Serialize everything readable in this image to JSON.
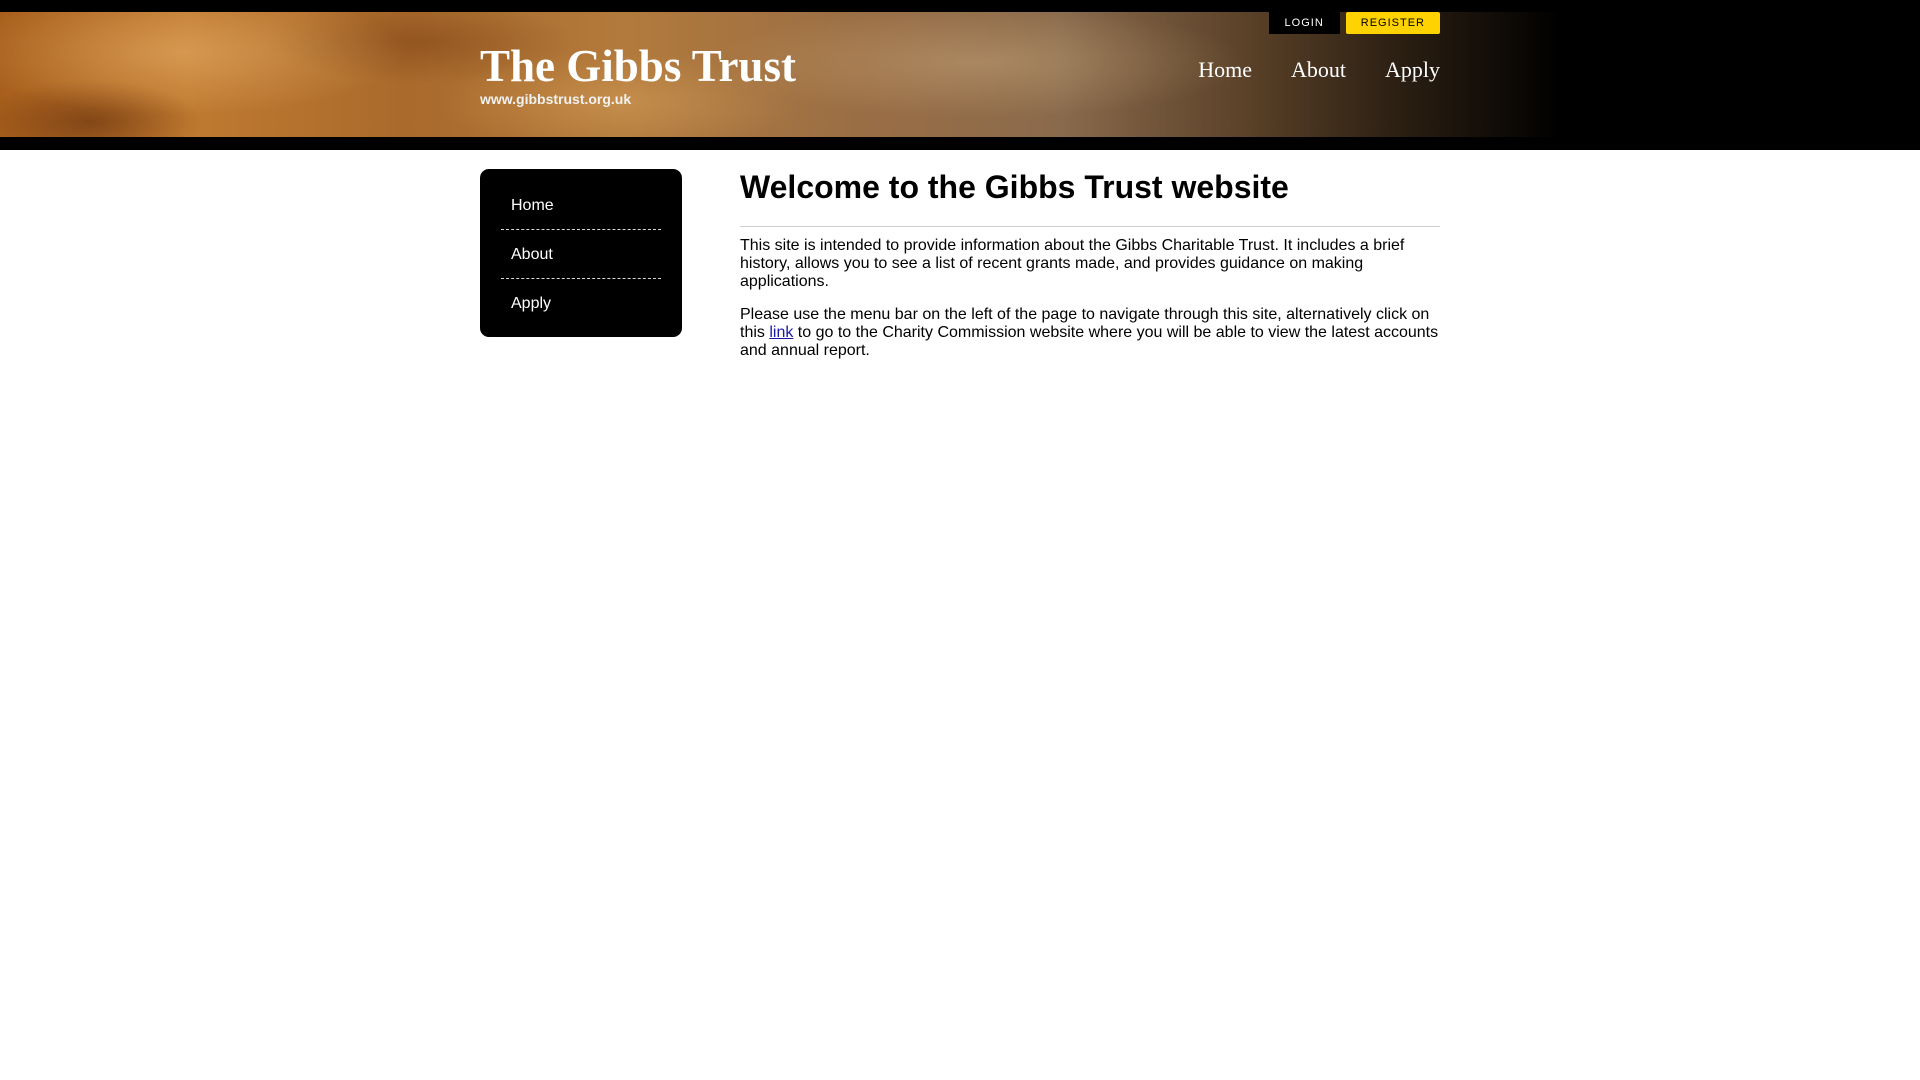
{
  "header": {
    "site_title": "The Gibbs Trust",
    "site_url": "www.gibbstrust.org.uk",
    "nav": [
      {
        "label": "Home"
      },
      {
        "label": "About"
      },
      {
        "label": "Apply"
      }
    ],
    "login_label": "LOGIN",
    "register_label": "REGISTER"
  },
  "sidebar": {
    "items": [
      {
        "label": "Home"
      },
      {
        "label": "About"
      },
      {
        "label": "Apply"
      }
    ]
  },
  "main": {
    "heading": "Welcome to the Gibbs Trust website",
    "paragraph1": "This site is intended to provide information about the Gibbs Charitable Trust. It includes a brief history, allows you to see a list of recent grants made, and provides guidance on making applications.",
    "paragraph2_before": "Please use the menu bar on the left of the page to navigate through this site, alternatively click on this ",
    "paragraph2_link": "link",
    "paragraph2_after": " to go to the Charity Commission website where you will be able to view the latest accounts and annual report."
  },
  "colors": {
    "register_bg": "#ffd200",
    "link": "#1a1aa6",
    "sidebar_bg": "#000000"
  }
}
